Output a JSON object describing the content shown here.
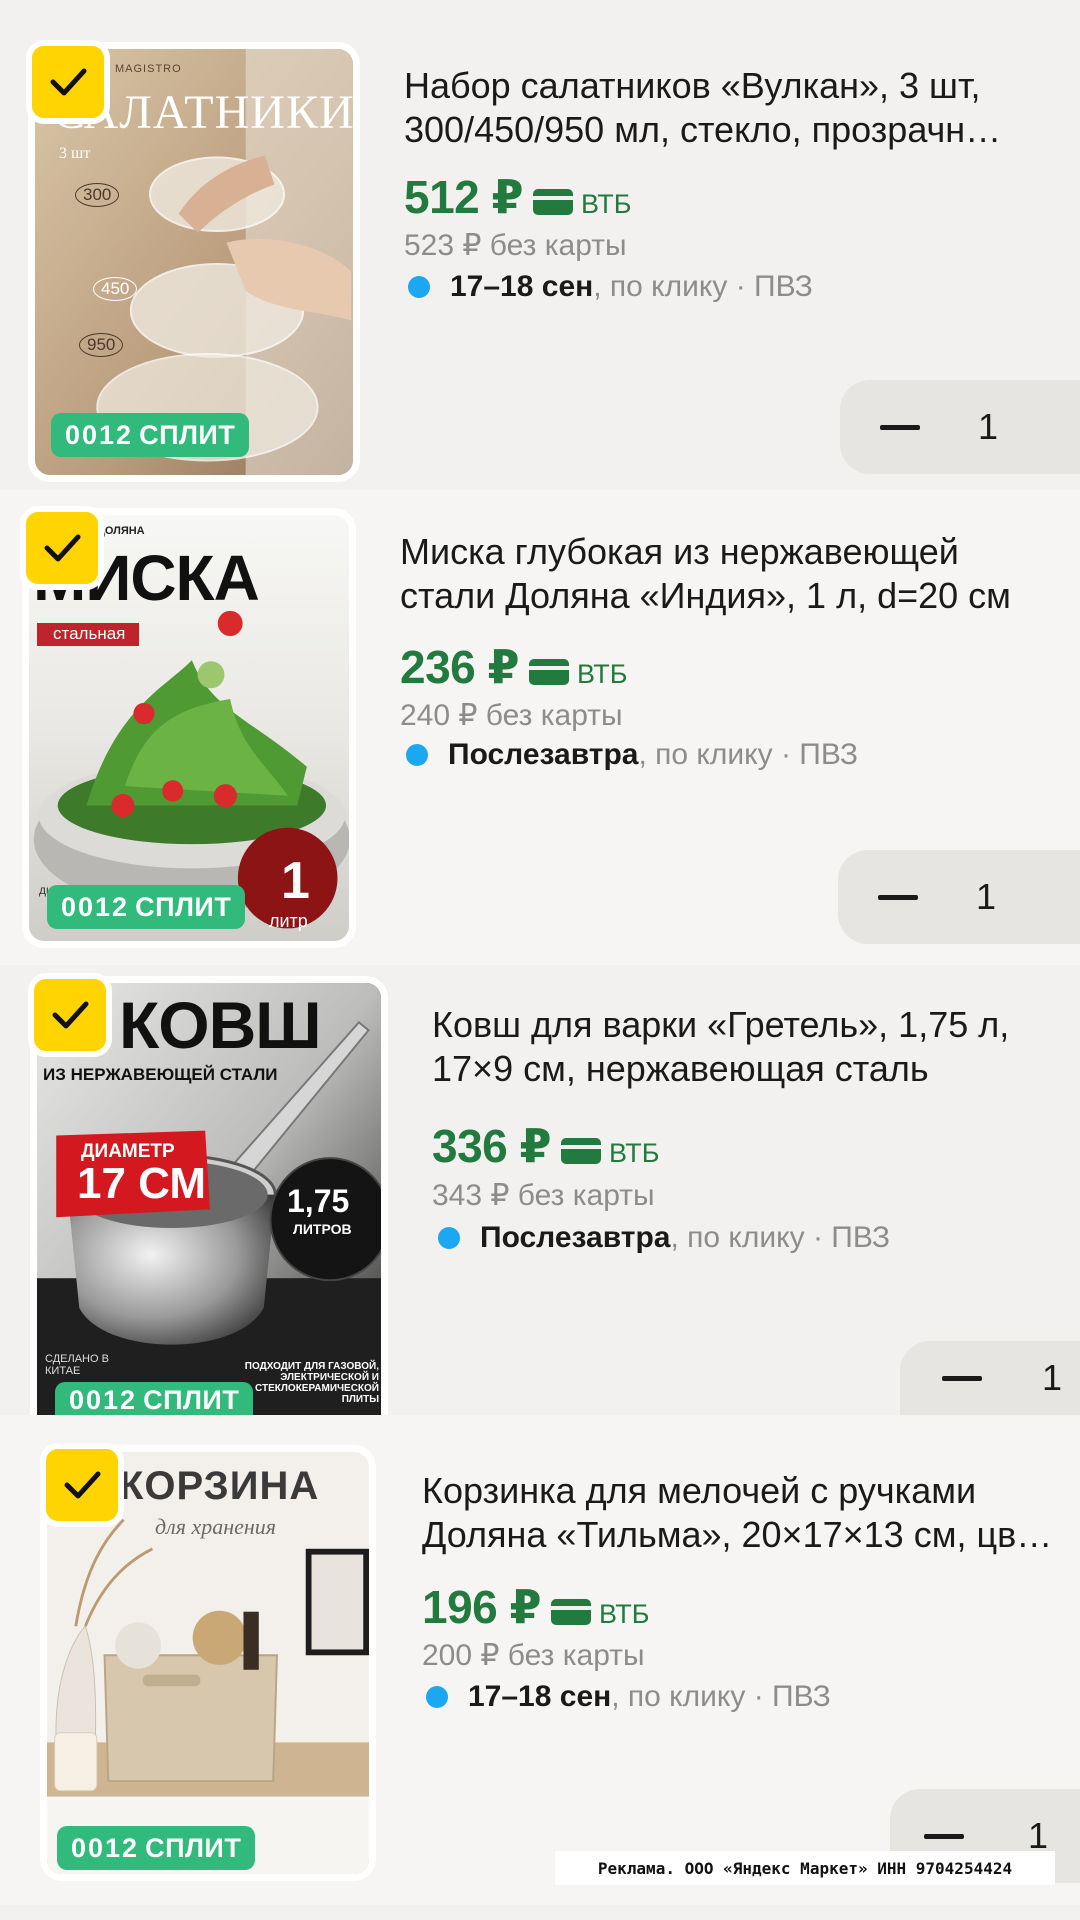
{
  "products": [
    {
      "title_lines": [
        "Набор салатников «Вулкан», 3 шт,",
        "300/450/950 мл, стекло, прозрачн…"
      ],
      "price": "512 ₽",
      "bank": "ВТБ",
      "old_price": "523 ₽ без карты",
      "delivery_date": "17–18 сен",
      "delivery_rest": ", по клику · ПВЗ",
      "quantity": "1",
      "image_text": {
        "headline": "САЛАТНИКИ",
        "brand": "MAGISTRO",
        "sub": "3 шт",
        "volumes": [
          "300",
          "450",
          "950"
        ]
      },
      "split": {
        "num": "0012",
        "label": "СПЛИТ"
      },
      "selected": true
    },
    {
      "title_lines": [
        "Миска глубокая из нержавеющей",
        "стали Доляна «Индия», 1 л, d=20 см"
      ],
      "price": "236 ₽",
      "bank": "ВТБ",
      "old_price": "240 ₽ без карты",
      "delivery_date": "Послезавтра",
      "delivery_rest": ", по клику · ПВЗ",
      "quantity": "1",
      "image_text": {
        "headline": "МИСКА",
        "brand": "ДОЛЯНА",
        "sub": "стальная",
        "note": "диаметр 20 см",
        "badge_num": "1",
        "badge_label": "литр"
      },
      "split": {
        "num": "0012",
        "label": "СПЛИТ"
      },
      "selected": true
    },
    {
      "title_lines": [
        "Ковш для варки «Гретель», 1,75 л,",
        "17×9 см, нержавеющая сталь"
      ],
      "price": "336 ₽",
      "bank": "ВТБ",
      "old_price": "343 ₽ без карты",
      "delivery_date": "Послезавтра",
      "delivery_rest": ", по клику · ПВЗ",
      "quantity": "1",
      "image_text": {
        "headline": "КОВШ",
        "sub": "ИЗ НЕРЖАВЕЮЩЕЙ СТАЛИ",
        "diam_label": "ДИАМЕТР",
        "diam_value": "17 СМ",
        "vol_value": "1,75",
        "vol_label": "ЛИТРОВ",
        "made": "СДЕЛАНО В КИТАЕ",
        "fits": "ПОДХОДИТ ДЛЯ ГАЗОВОЙ, ЭЛЕКТРИЧЕСКОЙ И СТЕКЛОКЕРАМИЧЕСКОЙ ПЛИТЫ"
      },
      "split": {
        "num": "0012",
        "label": "СПЛИТ"
      },
      "selected": true
    },
    {
      "title_lines": [
        "Корзинка для мелочей с ручками",
        "Доляна «Тильма», 20×17×13 см, цв…"
      ],
      "price": "196 ₽",
      "bank": "ВТБ",
      "old_price": "200 ₽ без карты",
      "delivery_date": "17–18 сен",
      "delivery_rest": ", по клику · ПВЗ",
      "quantity": "1",
      "image_text": {
        "headline": "КОРЗИНА",
        "sub": "для хранения"
      },
      "split": {
        "num": "0012",
        "label": "СПЛИТ"
      },
      "selected": true
    }
  ],
  "ad_note": "Реклама. ООО «Яндекс Маркет» ИНН 9704254424",
  "colors": {
    "price_green": "#237a3e",
    "split_green": "#32b97c",
    "check_yellow": "#ffd400",
    "delivery_dot": "#1ba7f2",
    "background": "#f2f1ef"
  },
  "icons": [
    "checkmark-icon",
    "bank-card-icon",
    "minus-icon",
    "delivery-dot-icon"
  ]
}
